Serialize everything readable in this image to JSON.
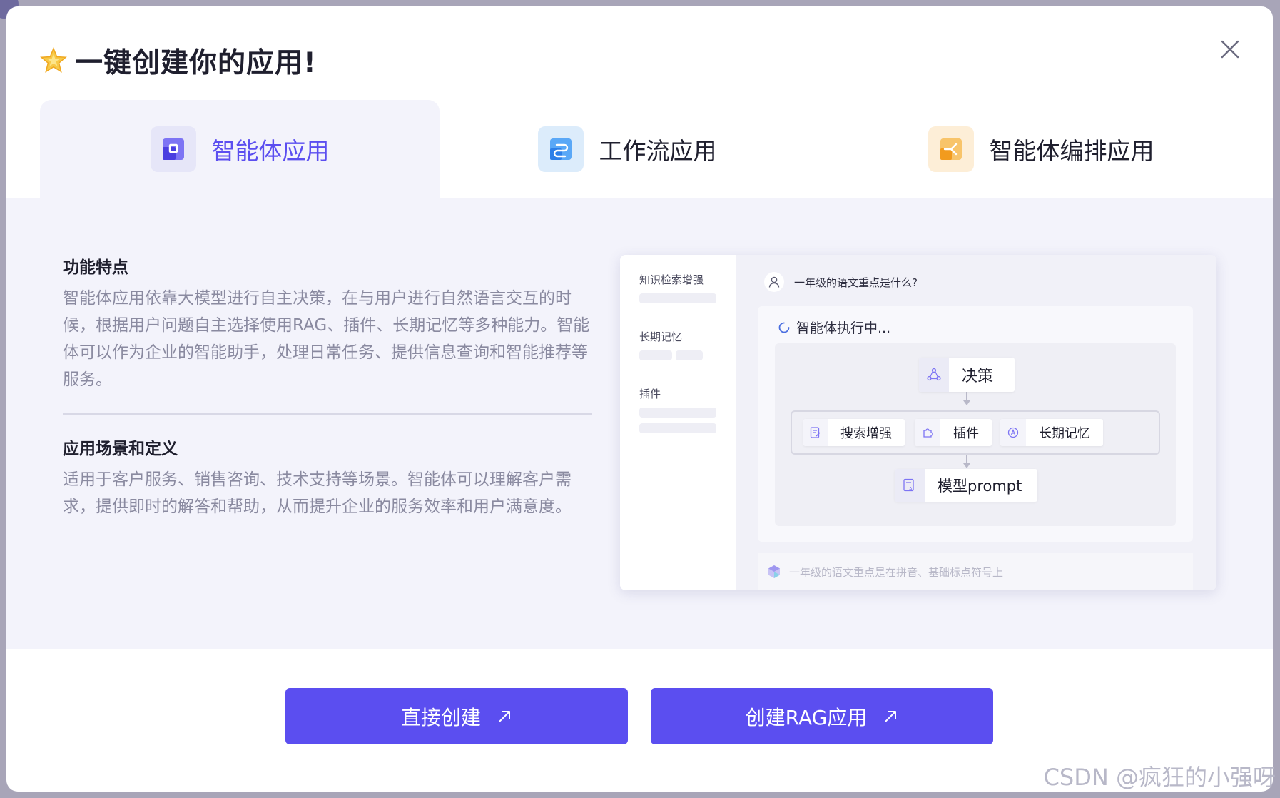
{
  "dialog": {
    "title": "一键创建你的应用!",
    "star_icon": "star-icon",
    "close_icon": "close-icon"
  },
  "tabs": [
    {
      "label": "智能体应用",
      "icon": "agent-app-icon",
      "active": true,
      "icon_bg": "#e6e6f8",
      "icon_color": "#5b4ef0"
    },
    {
      "label": "工作流应用",
      "icon": "workflow-app-icon",
      "active": false,
      "icon_bg": "#dcecfb",
      "icon_color": "#3b8ef5"
    },
    {
      "label": "智能体编排应用",
      "icon": "agent-orchestration-icon",
      "active": false,
      "icon_bg": "#fdeed7",
      "icon_color": "#f5a623"
    }
  ],
  "features": {
    "title": "功能特点",
    "text": "智能体应用依靠大模型进行自主决策，在与用户进行自然语言交互的时候，根据用户问题自主选择使用RAG、插件、长期记忆等多种能力。智能体可以作为企业的智能助手，处理日常任务、提供信息查询和智能推荐等服务。"
  },
  "scenarios": {
    "title": "应用场景和定义",
    "text": "适用于客户服务、销售咨询、技术支持等场景。智能体可以理解客户需求，提供即时的解答和帮助，从而提升企业的服务效率和用户满意度。"
  },
  "preview": {
    "side_labels": [
      "知识检索增强",
      "长期记忆",
      "插件"
    ],
    "question": "一年级的语文重点是什么?",
    "exec_status": "智能体执行中...",
    "nodes": {
      "decision": "决策",
      "search": "搜索增强",
      "plugin": "插件",
      "memory": "长期记忆",
      "prompt": "模型prompt"
    },
    "answer": "一年级的语文重点是在拼音、基础标点符号上"
  },
  "buttons": {
    "create_direct": "直接创建",
    "create_rag": "创建RAG应用",
    "arrow_icon": "arrow-up-right-icon"
  },
  "watermark": "CSDN @疯狂的小强呀",
  "colors": {
    "accent": "#5b4ef0",
    "panel_bg": "#f3f3fb",
    "muted_text": "#8a8aa0"
  }
}
